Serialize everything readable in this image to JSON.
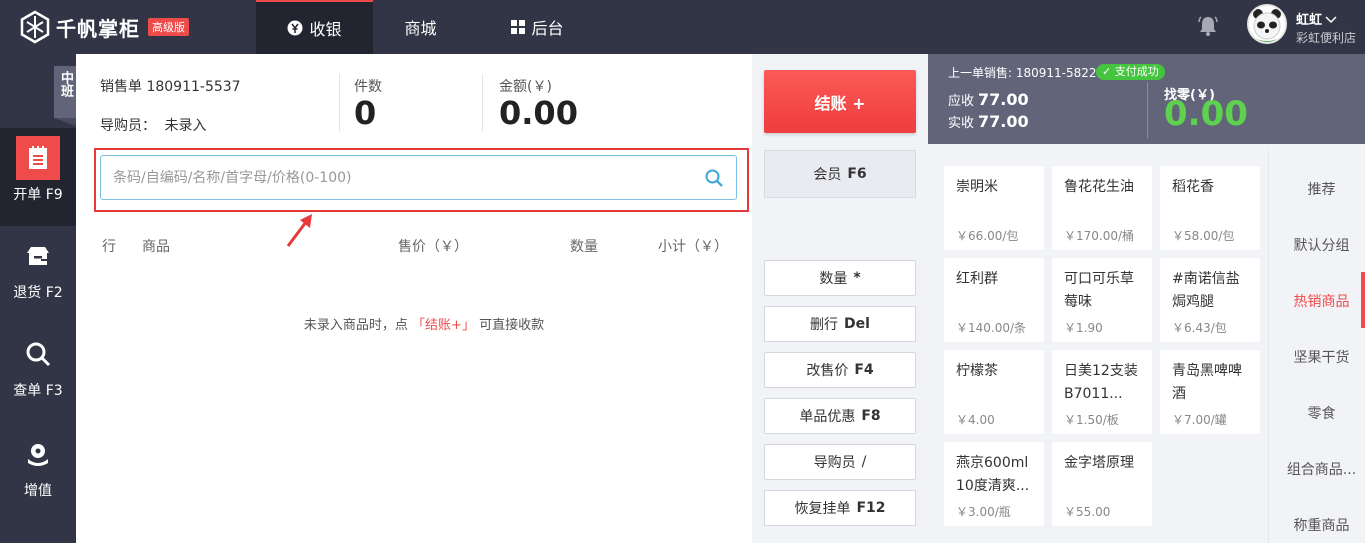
{
  "header": {
    "brand": "千帆掌柜",
    "edition_badge": "高级版",
    "tabs": [
      {
        "label": "收银",
        "icon": "yen-circle-icon",
        "active": true
      },
      {
        "label": "商城",
        "icon": "",
        "active": false
      },
      {
        "label": "后台",
        "icon": "grid-icon",
        "active": false
      }
    ],
    "user": {
      "name": "虹虹",
      "shop": "彩虹便利店"
    }
  },
  "sidebar": {
    "shift": "中班",
    "items": [
      {
        "label": "开单 F9",
        "icon": "open-order-icon",
        "active": true
      },
      {
        "label": "退货 F2",
        "icon": "return-box-icon",
        "active": false
      },
      {
        "label": "查单 F3",
        "icon": "search-icon",
        "active": false
      },
      {
        "label": "增值",
        "icon": "plant-icon",
        "active": false
      }
    ]
  },
  "order": {
    "sale_no_label": "销售单 180911-5537",
    "guide_label": "导购员：",
    "guide_value": "未录入",
    "count_label": "件数",
    "count_value": "0",
    "amount_label": "金额(￥)",
    "amount_value": "0.00",
    "search_placeholder": "条码/自编码/名称/首字母/价格(0-100)",
    "columns": {
      "row": "行",
      "item": "商品",
      "price": "售价（￥）",
      "qty": "数量",
      "subtotal": "小计（￥）"
    },
    "empty_hint_before": "未录入商品时，点",
    "empty_hint_link": "「结账+」",
    "empty_hint_after": "可直接收款"
  },
  "actions": {
    "checkout": "结账 +",
    "member": {
      "label": "会员",
      "key": "F6"
    },
    "buttons": [
      {
        "label": "数量",
        "key": "*"
      },
      {
        "label": "删行",
        "key": "Del"
      },
      {
        "label": "改售价",
        "key": "F4"
      },
      {
        "label": "单品优惠",
        "key": "F8"
      },
      {
        "label": "导购员",
        "key": "/"
      },
      {
        "label": "恢复挂单",
        "key": "F12"
      }
    ]
  },
  "last_sale": {
    "label": "上一单销售: 180911-5822",
    "status": "✓ 支付成功",
    "due_label": "应收",
    "due_value": "77.00",
    "paid_label": "实收",
    "paid_value": "77.00",
    "change_label": "找零(￥)",
    "change_value": "0.00"
  },
  "products": [
    {
      "name": "崇明米",
      "price": "￥66.00/包"
    },
    {
      "name": "鲁花花生油",
      "price": "￥170.00/桶"
    },
    {
      "name": "稻花香",
      "price": "￥58.00/包"
    },
    {
      "name": "红利群",
      "price": "￥140.00/条"
    },
    {
      "name": "可口可乐草莓味",
      "price": "￥1.90"
    },
    {
      "name": "#南诺信盐焗鸡腿",
      "price": "￥6.43/包"
    },
    {
      "name": "柠檬茶",
      "price": "￥4.00"
    },
    {
      "name": "日美12支装B7011...",
      "price": "￥1.50/板"
    },
    {
      "name": "青岛黑啤啤酒",
      "price": "￥7.00/罐"
    },
    {
      "name": "燕京600ml 10度清爽...",
      "price": "￥3.00/瓶"
    },
    {
      "name": "金字塔原理",
      "price": "￥55.00"
    }
  ],
  "categories": [
    {
      "label": "推荐",
      "active": false
    },
    {
      "label": "默认分组",
      "active": false
    },
    {
      "label": "热销商品",
      "active": true
    },
    {
      "label": "坚果干货",
      "active": false
    },
    {
      "label": "零食",
      "active": false
    },
    {
      "label": "组合商品...",
      "active": false
    },
    {
      "label": "称重商品",
      "active": false
    }
  ],
  "colors": {
    "accent": "#f04b4b",
    "header": "#323545",
    "success": "#45c53f",
    "change": "#5ed14e",
    "search_border": "#7cc1df"
  }
}
